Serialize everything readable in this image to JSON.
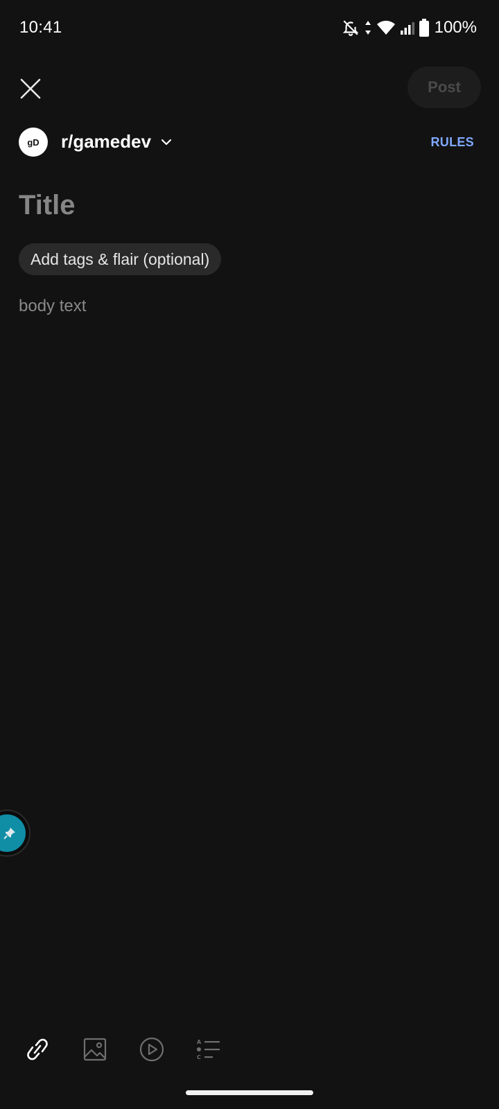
{
  "status_bar": {
    "time": "10:41",
    "battery": "100%",
    "icons": [
      "bell-off-icon",
      "data-arrows-icon",
      "wifi-icon",
      "signal-icon",
      "battery-icon"
    ]
  },
  "header": {
    "close_icon": "close-icon",
    "post_label": "Post"
  },
  "community": {
    "avatar_text": "gD",
    "name": "r/gamedev",
    "rules_label": "RULES"
  },
  "editor": {
    "title_placeholder": "Title",
    "flair_label": "Add tags & flair (optional)",
    "body_placeholder": "body text"
  },
  "toolbar": {
    "icons": [
      "link-icon",
      "image-icon",
      "video-icon",
      "poll-icon"
    ]
  },
  "colors": {
    "background": "#121212",
    "accent_link": "#7fa8ff",
    "chip_bg": "#2a2a2a",
    "bubble": "#0f8ea6"
  }
}
